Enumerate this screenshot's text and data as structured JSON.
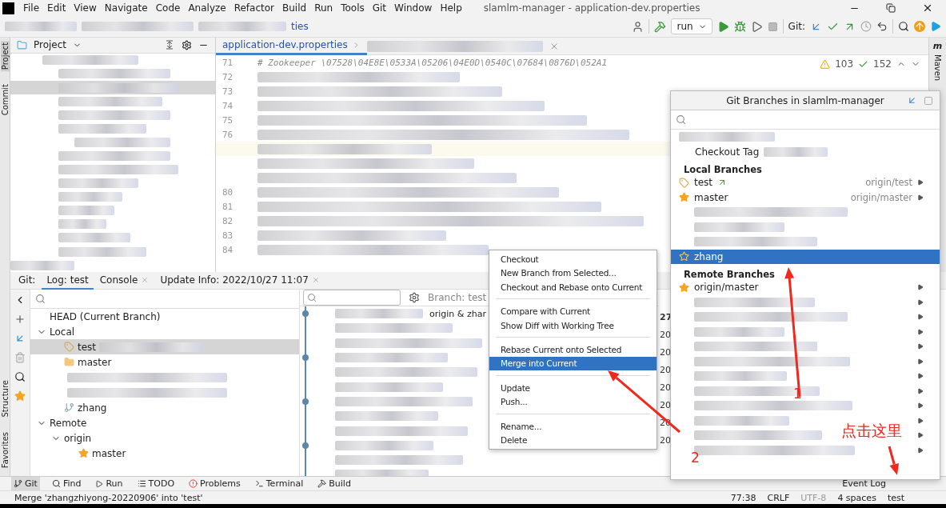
{
  "window": {
    "title": "slamlm-manager - application-dev.properties"
  },
  "menu": [
    "File",
    "Edit",
    "View",
    "Navigate",
    "Code",
    "Analyze",
    "Refactor",
    "Build",
    "Run",
    "Tools",
    "Git",
    "Window",
    "Help"
  ],
  "breadcrumb": {
    "tail": "ties"
  },
  "toolbar": {
    "run_config": "run",
    "git_label": "Git:"
  },
  "left_stripe_top": [
    "Project",
    "Commit"
  ],
  "left_stripe_bottom": [
    "Structure",
    "Favorites"
  ],
  "right_stripe": [
    "Maven"
  ],
  "maven_icon": "m",
  "project_panel": {
    "title": "Project"
  },
  "editor": {
    "tab": "application-dev.properties",
    "warnings": "103",
    "checks": "152",
    "lines": [
      {
        "number": "71",
        "text": "# Zookeeper \\07528\\04E8E\\0533A\\05206\\04E0D\\0540C\\07684\\0876D\\052A1",
        "current": false
      },
      {
        "number": "72",
        "current": false
      },
      {
        "number": "73",
        "current": false
      },
      {
        "number": "74",
        "current": false
      },
      {
        "number": "75",
        "current": false
      },
      {
        "number": "76",
        "current": false
      },
      {
        "current": true
      },
      {
        "current": false
      },
      {
        "current": false
      },
      {
        "number": "80",
        "current": false
      },
      {
        "number": "81",
        "current": false
      },
      {
        "number": "82",
        "current": false
      },
      {
        "number": "83",
        "current": false
      },
      {
        "number": "84",
        "current": false
      }
    ]
  },
  "bottom_tabs": [
    {
      "label": "Git:",
      "selected": false
    },
    {
      "label": "Log: test",
      "selected": true
    },
    {
      "label": "Console",
      "selected": false,
      "closable": true
    },
    {
      "label": "Update Info: 2022/10/27 11:07",
      "selected": false,
      "closable": true
    }
  ],
  "branch_tree": [
    {
      "label": "HEAD (Current Branch)",
      "kind": "head",
      "selected": false
    },
    {
      "label": "Local",
      "kind": "group",
      "expanded": true,
      "selected": false,
      "children": [
        {
          "label": "test",
          "kind": "tag",
          "selected": true
        },
        {
          "label": "master",
          "kind": "folder",
          "selected": false
        },
        {
          "kind": "hidden",
          "selected": false
        },
        {
          "kind": "hidden",
          "selected": false
        },
        {
          "label": "zhang",
          "kind": "branch",
          "selected": false
        }
      ]
    },
    {
      "label": "Remote",
      "kind": "group",
      "expanded": true,
      "selected": false,
      "children": [
        {
          "label": "origin",
          "kind": "group",
          "expanded": true,
          "selected": false,
          "children": [
            {
              "label": "master",
              "kind": "star",
              "selected": false
            }
          ]
        }
      ]
    }
  ],
  "log": {
    "branch_filter": "Branch: test",
    "ref_label": "origin & zhar",
    "dates": [
      "27",
      "20",
      "20",
      "20",
      "20",
      "20",
      "20",
      "20"
    ]
  },
  "context_menu": [
    [
      {
        "label": "Checkout",
        "selected": false
      },
      {
        "label": "New Branch from Selected...",
        "selected": false
      },
      {
        "label": "Checkout and Rebase onto Current",
        "selected": false
      }
    ],
    [
      {
        "label": "Compare with Current",
        "selected": false
      },
      {
        "label": "Show Diff with Working Tree",
        "selected": false
      }
    ],
    [
      {
        "label": "Rebase Current onto Selected",
        "selected": false
      },
      {
        "label": "Merge into Current",
        "selected": true
      }
    ],
    [
      {
        "label": "Update",
        "selected": false
      },
      {
        "label": "Push...",
        "selected": false
      }
    ],
    [
      {
        "label": "Rename...",
        "selected": false
      },
      {
        "label": "Delete",
        "selected": false
      }
    ]
  ],
  "git_branches": {
    "title": "Git Branches in slamlm-manager",
    "actions": [
      "Checkout Tag"
    ],
    "sections": [
      {
        "title": "Local Branches",
        "items": [
          {
            "label": "test",
            "kind": "tag",
            "tracking": "origin/test",
            "selected": false
          },
          {
            "label": "master",
            "kind": "star",
            "tracking": "origin/master",
            "selected": false
          },
          {
            "kind": "hidden",
            "selected": false
          },
          {
            "kind": "hidden",
            "selected": false
          },
          {
            "kind": "hidden",
            "selected": false
          },
          {
            "label": "zhang",
            "kind": "outline_star",
            "selected": true
          }
        ]
      },
      {
        "title": "Remote Branches",
        "items": [
          {
            "label": "origin/master",
            "kind": "star",
            "selected": false
          },
          {
            "kind": "hidden",
            "selected": false
          },
          {
            "kind": "hidden",
            "selected": false
          },
          {
            "kind": "hidden",
            "selected": false
          },
          {
            "kind": "hidden",
            "selected": false
          },
          {
            "kind": "hidden",
            "selected": false
          },
          {
            "kind": "hidden",
            "selected": false
          },
          {
            "kind": "hidden",
            "selected": false
          },
          {
            "kind": "hidden",
            "selected": false
          },
          {
            "kind": "hidden",
            "selected": false
          },
          {
            "kind": "hidden",
            "selected": false
          },
          {
            "kind": "hidden",
            "selected": false
          }
        ]
      }
    ]
  },
  "tool_windows": [
    "Git",
    "Find",
    "Run",
    "TODO",
    "Problems",
    "Terminal",
    "Build"
  ],
  "event_log": "Event Log",
  "status_bar": {
    "message": "Merge 'zhangzhiyong-20220906' into 'test'",
    "position": "77:38",
    "line_sep": "CRLF",
    "encoding": "UTF-8",
    "indent": "4 spaces",
    "branch": "test"
  },
  "annotations": [
    {
      "label": "1"
    },
    {
      "label": "2"
    },
    {
      "label": "点击这里"
    }
  ]
}
